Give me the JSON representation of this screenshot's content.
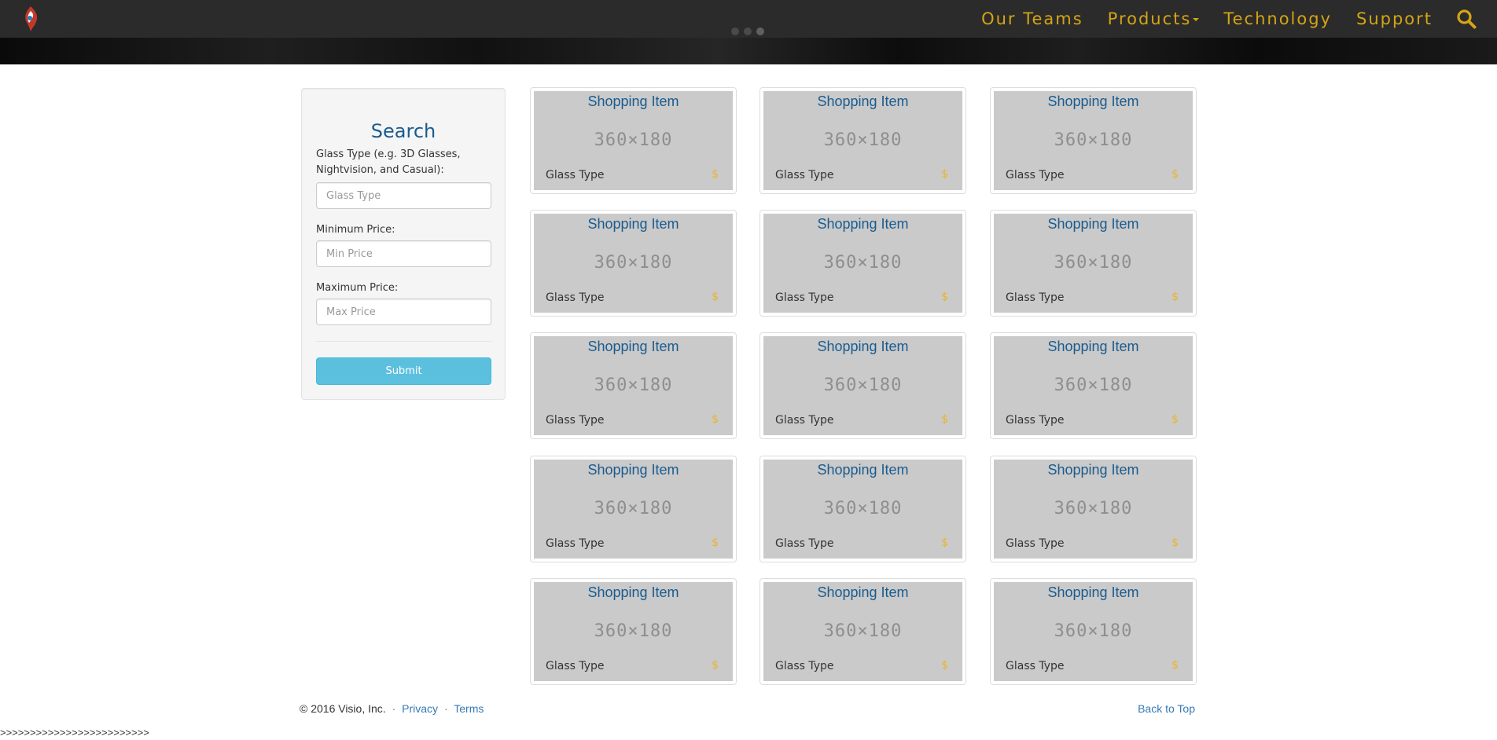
{
  "navbar": {
    "logo_icon": "visio-logo-icon",
    "links": [
      {
        "label": "Our Teams"
      },
      {
        "label": "Products",
        "has_dropdown": true
      },
      {
        "label": "Technology"
      },
      {
        "label": "Support"
      }
    ],
    "search_icon": "search-icon",
    "link_color": "#d4a514",
    "background": "#2b2b2b"
  },
  "search": {
    "title": "Search",
    "glass_type_label": "Glass Type (e.g. 3D Glasses, Nightvision, and Casual):",
    "glass_type_placeholder": "Glass Type",
    "min_price_label": "Minimum Price:",
    "min_price_placeholder": "Min Price",
    "max_price_label": "Maximum Price:",
    "max_price_placeholder": "Max Price",
    "submit_label": "Submit",
    "submit_color": "#5bc0de"
  },
  "products": [
    {
      "title": "Shopping Item",
      "image_placeholder": "360×180",
      "type": "Glass Type",
      "price": "$"
    },
    {
      "title": "Shopping Item",
      "image_placeholder": "360×180",
      "type": "Glass Type",
      "price": "$"
    },
    {
      "title": "Shopping Item",
      "image_placeholder": "360×180",
      "type": "Glass Type",
      "price": "$"
    },
    {
      "title": "Shopping Item",
      "image_placeholder": "360×180",
      "type": "Glass Type",
      "price": "$"
    },
    {
      "title": "Shopping Item",
      "image_placeholder": "360×180",
      "type": "Glass Type",
      "price": "$"
    },
    {
      "title": "Shopping Item",
      "image_placeholder": "360×180",
      "type": "Glass Type",
      "price": "$"
    },
    {
      "title": "Shopping Item",
      "image_placeholder": "360×180",
      "type": "Glass Type",
      "price": "$"
    },
    {
      "title": "Shopping Item",
      "image_placeholder": "360×180",
      "type": "Glass Type",
      "price": "$"
    },
    {
      "title": "Shopping Item",
      "image_placeholder": "360×180",
      "type": "Glass Type",
      "price": "$"
    },
    {
      "title": "Shopping Item",
      "image_placeholder": "360×180",
      "type": "Glass Type",
      "price": "$"
    },
    {
      "title": "Shopping Item",
      "image_placeholder": "360×180",
      "type": "Glass Type",
      "price": "$"
    },
    {
      "title": "Shopping Item",
      "image_placeholder": "360×180",
      "type": "Glass Type",
      "price": "$"
    },
    {
      "title": "Shopping Item",
      "image_placeholder": "360×180",
      "type": "Glass Type",
      "price": "$"
    },
    {
      "title": "Shopping Item",
      "image_placeholder": "360×180",
      "type": "Glass Type",
      "price": "$"
    },
    {
      "title": "Shopping Item",
      "image_placeholder": "360×180",
      "type": "Glass Type",
      "price": "$"
    }
  ],
  "footer": {
    "copyright": "© 2016 Visio, Inc.",
    "separator": "·",
    "privacy_label": "Privacy",
    "terms_label": "Terms",
    "back_to_top_label": "Back to Top",
    "debug_text": ">>>>>>>>>>>>>>>>>>>>>>>>>"
  }
}
